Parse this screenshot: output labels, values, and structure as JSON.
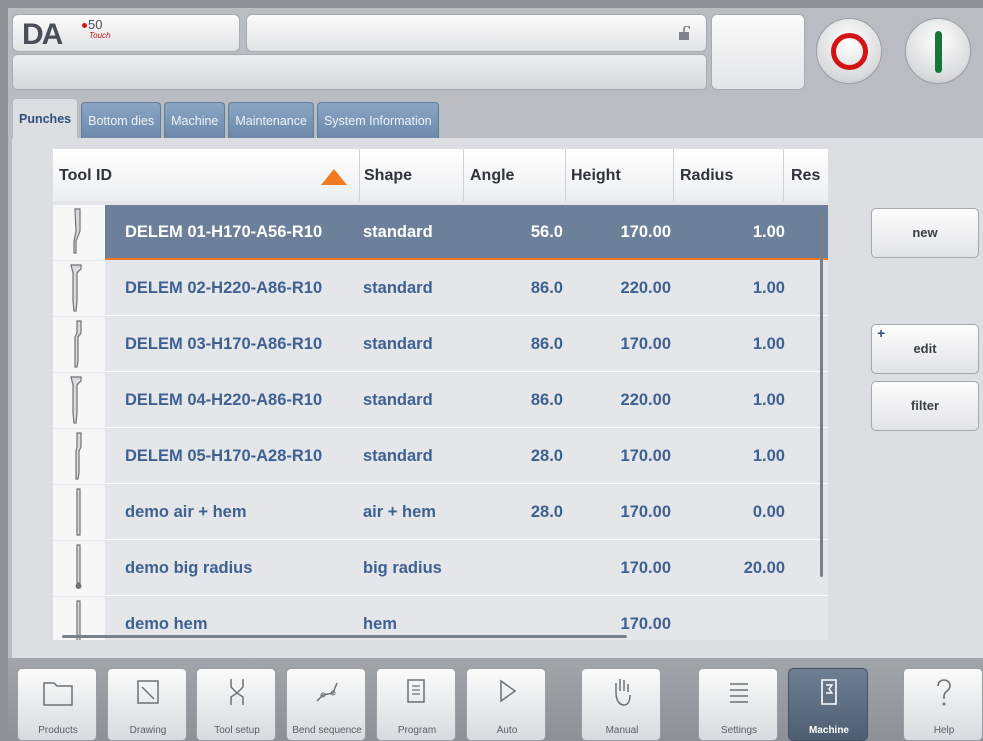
{
  "header": {
    "logo_text": "DA",
    "logo_number": "50",
    "logo_sub": "Touch",
    "title": "",
    "status": ""
  },
  "tabs": [
    {
      "label": "Punches",
      "active": true
    },
    {
      "label": "Bottom dies",
      "active": false
    },
    {
      "label": "Machine",
      "active": false
    },
    {
      "label": "Maintenance",
      "active": false
    },
    {
      "label": "System Information",
      "active": false
    }
  ],
  "table": {
    "columns": [
      "Tool ID",
      "Shape",
      "Angle",
      "Height",
      "Radius",
      "Res"
    ],
    "sort_column": "Tool ID",
    "rows": [
      {
        "id": "DELEM 01-H170-A56-R10",
        "shape": "standard",
        "angle": "56.0",
        "height": "170.00",
        "radius": "1.00",
        "selected": true
      },
      {
        "id": "DELEM 02-H220-A86-R10",
        "shape": "standard",
        "angle": "86.0",
        "height": "220.00",
        "radius": "1.00",
        "selected": false
      },
      {
        "id": "DELEM 03-H170-A86-R10",
        "shape": "standard",
        "angle": "86.0",
        "height": "170.00",
        "radius": "1.00",
        "selected": false
      },
      {
        "id": "DELEM 04-H220-A86-R10",
        "shape": "standard",
        "angle": "86.0",
        "height": "220.00",
        "radius": "1.00",
        "selected": false
      },
      {
        "id": "DELEM 05-H170-A28-R10",
        "shape": "standard",
        "angle": "28.0",
        "height": "170.00",
        "radius": "1.00",
        "selected": false
      },
      {
        "id": "demo air + hem",
        "shape": "air + hem",
        "angle": "28.0",
        "height": "170.00",
        "radius": "0.00",
        "selected": false
      },
      {
        "id": "demo big radius",
        "shape": "big radius",
        "angle": "",
        "height": "170.00",
        "radius": "20.00",
        "selected": false
      },
      {
        "id": "demo hem",
        "shape": "hem",
        "angle": "",
        "height": "170.00",
        "radius": "",
        "selected": false
      }
    ]
  },
  "side_buttons": {
    "new": "new",
    "edit": "edit",
    "edit_plus": "+",
    "filter": "filter"
  },
  "nav": [
    {
      "label": "Products",
      "icon": "folder-icon"
    },
    {
      "label": "Drawing",
      "icon": "drawing-icon"
    },
    {
      "label": "Tool setup",
      "icon": "tool-setup-icon"
    },
    {
      "label": "Bend sequence",
      "icon": "bend-sequence-icon"
    },
    {
      "label": "Program",
      "icon": "program-icon"
    },
    {
      "label": "Auto",
      "icon": "play-icon"
    },
    {
      "label": "Manual",
      "icon": "hand-icon"
    },
    {
      "label": "Settings",
      "icon": "settings-list-icon"
    },
    {
      "label": "Machine",
      "icon": "machine-icon",
      "active": true
    },
    {
      "label": "Help",
      "icon": "help-icon"
    }
  ],
  "colors": {
    "accent": "#f07a21",
    "selected_row": "#6c8199",
    "row_text": "#3e6191",
    "stop": "#d41414",
    "start": "#16773a"
  }
}
